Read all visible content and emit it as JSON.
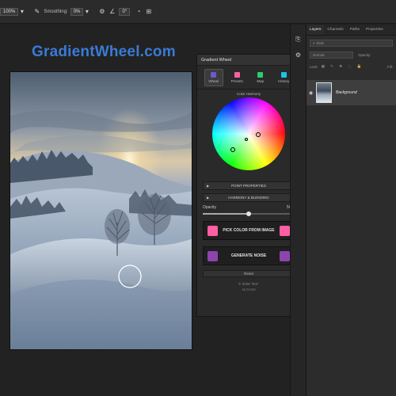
{
  "options_bar": {
    "zoom": "100%",
    "smoothing_label": "Smoothing:",
    "smoothing_value": "0%",
    "angle_value": "0°"
  },
  "brand": {
    "title": "GradientWheel.com",
    "color": "#3a7bd5"
  },
  "gradient_wheel_panel": {
    "title": "Gradient Wheel",
    "tabs": [
      {
        "label": "Wheel",
        "color": "#6a5acd"
      },
      {
        "label": "Presets",
        "color": "#ff5fa2"
      },
      {
        "label": "Map",
        "color": "#2ecc71"
      },
      {
        "label": "History",
        "color": "#19c7e0"
      }
    ],
    "harmony_label": "Color Harmony",
    "point_properties": "POINT PROPERTIES",
    "harmony_blending": "HARMONY & BLENDING",
    "opacity_label": "Opacity",
    "opacity_value": "50%",
    "opacity_fraction": 0.5,
    "pick_color_label": "PICK COLOR FROM IMAGE",
    "pick_color_swatch": "#ff5fa2",
    "generate_noise_label": "GENERATE NOISE",
    "generate_noise_swatch": "#8e44ad",
    "reset_label": "Reset",
    "footer_line1": "© 2025 \"Em\"",
    "footer_line2": "v1.0 rcm"
  },
  "layers_panel": {
    "tabs": [
      "Layers",
      "Channels",
      "Paths",
      "Properties"
    ],
    "kind_label": "Kind",
    "normal_label": "Normal",
    "opacity_label": "Opacity:",
    "lock_label": "Lock:",
    "fill_label": "Fill:",
    "layer_name": "Background"
  }
}
